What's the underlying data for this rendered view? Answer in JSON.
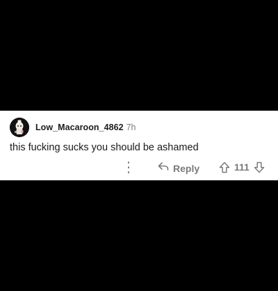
{
  "comment": {
    "username": "Low_Macaroon_4862",
    "time_ago": "7h",
    "body": "this fucking sucks you should be ashamed",
    "avatar_icon": "user-avatar-icon"
  },
  "actions": {
    "more_icon": "more-vertical-icon",
    "reply_icon": "reply-arrow-icon",
    "reply_label": "Reply",
    "upvote_icon": "upvote-arrow-icon",
    "vote_count": "111",
    "downvote_icon": "downvote-arrow-icon"
  },
  "colors": {
    "background": "#000000",
    "card": "#ffffff",
    "text_primary": "#1a1a1b",
    "text_muted": "#7a7a7a"
  }
}
